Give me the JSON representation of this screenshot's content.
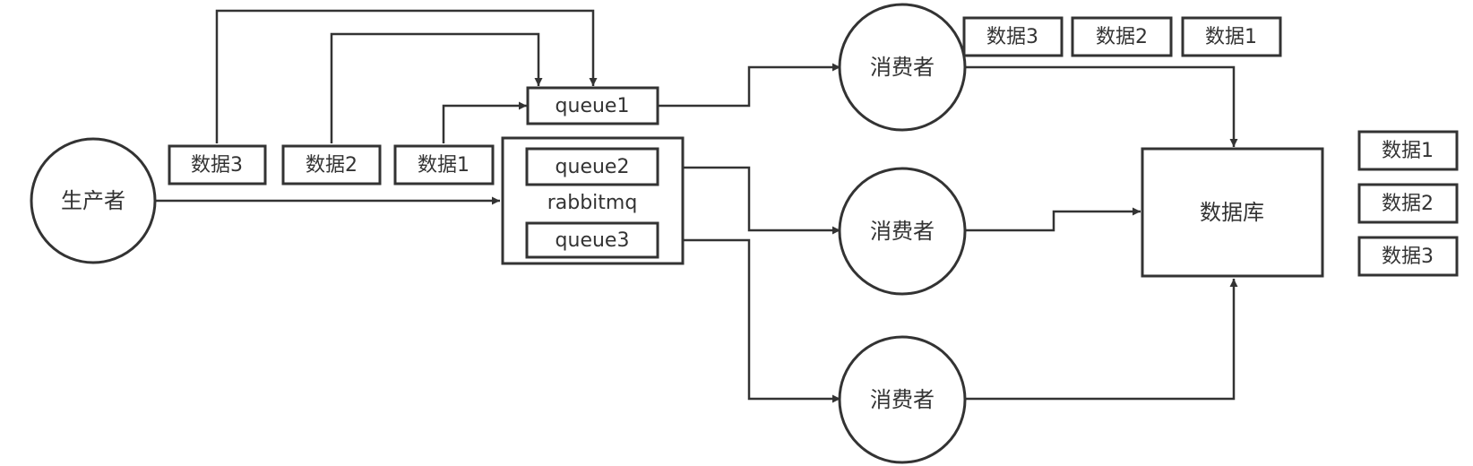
{
  "diagram": {
    "producer": "生产者",
    "broker": "rabbitmq",
    "queues": [
      "queue1",
      "queue2",
      "queue3"
    ],
    "producer_messages": [
      "数据3",
      "数据2",
      "数据1"
    ],
    "consumer_label": "消费者",
    "consumer_messages": [
      "数据3",
      "数据2",
      "数据1"
    ],
    "database": "数据库",
    "database_records": [
      "数据1",
      "数据2",
      "数据3"
    ]
  }
}
